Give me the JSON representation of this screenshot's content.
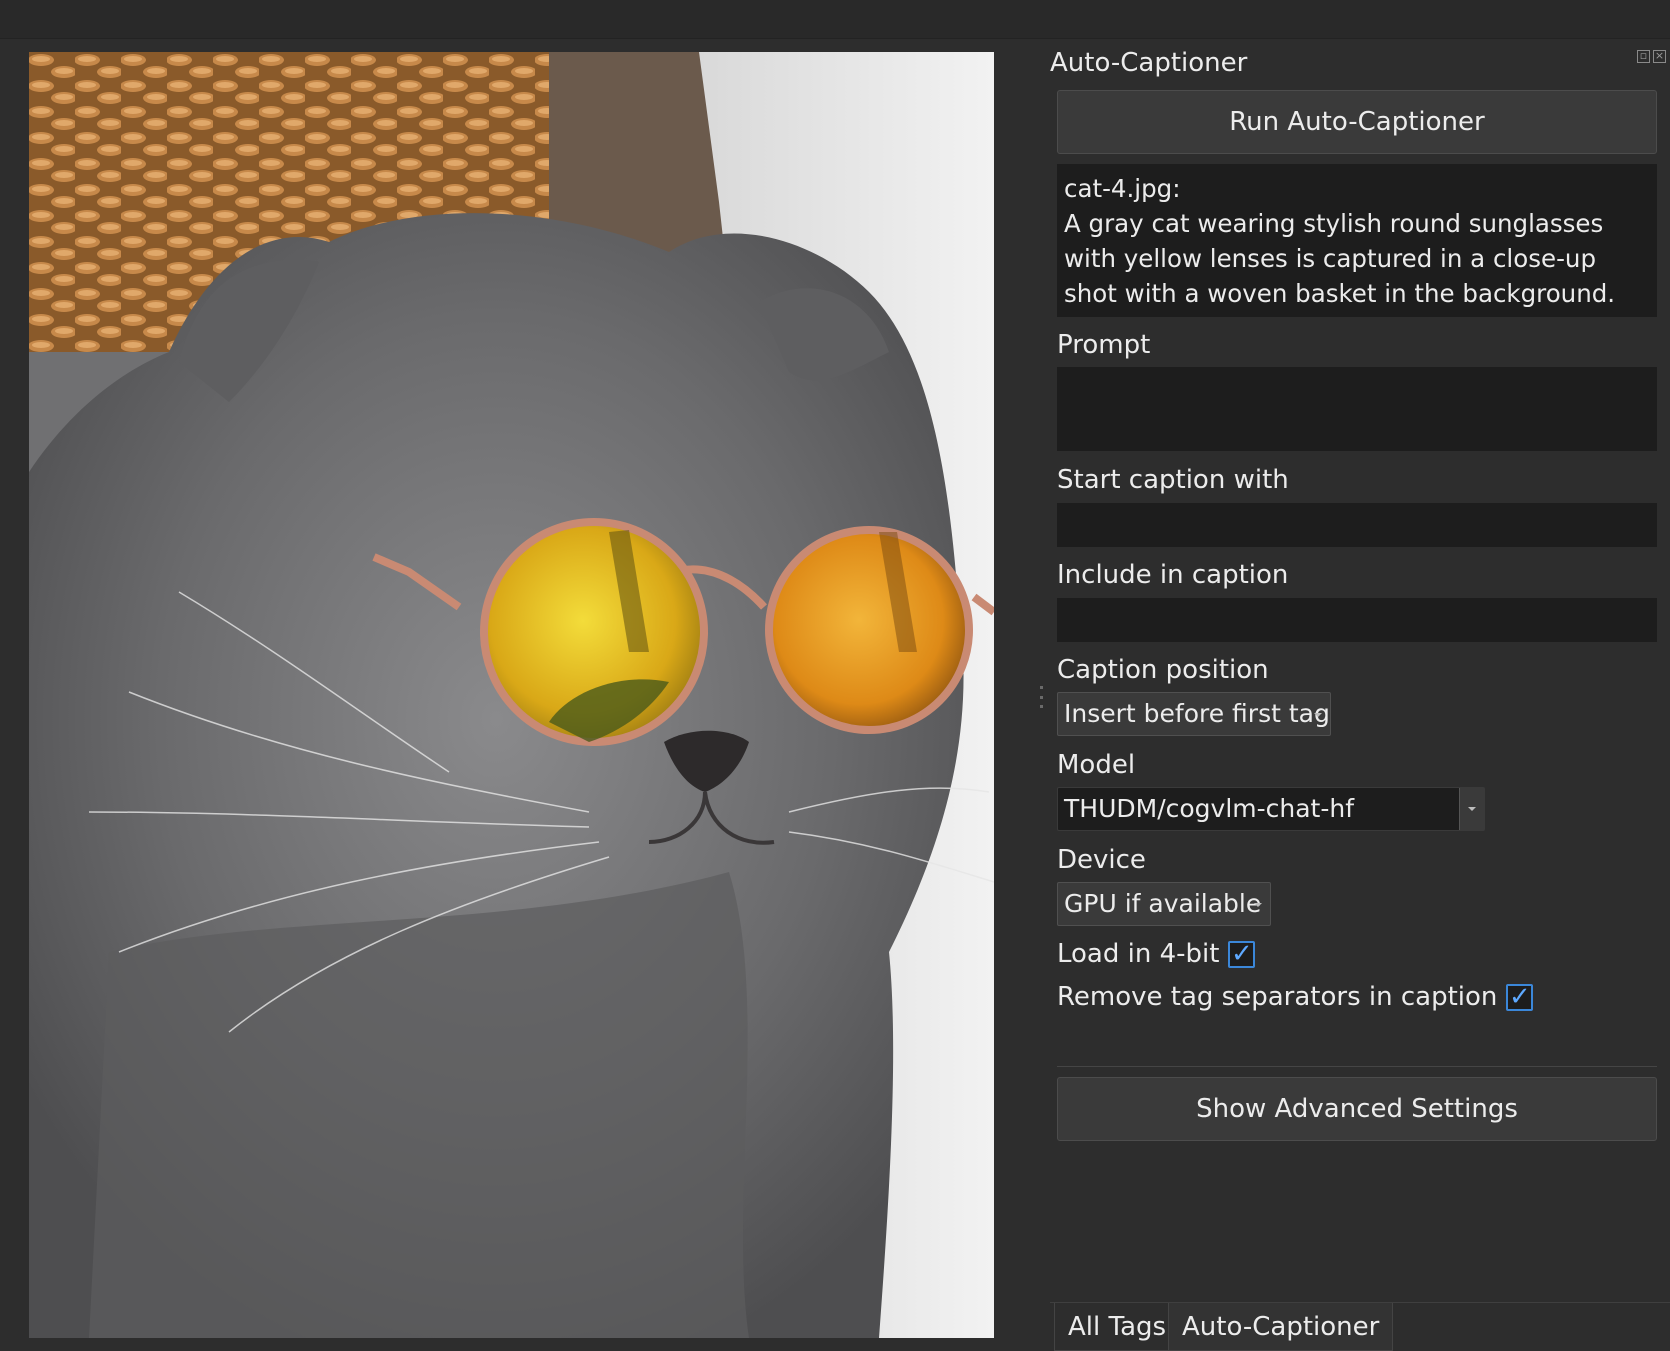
{
  "image": {
    "alt": "cat-4.jpg"
  },
  "dock": {
    "title": "Auto-Captioner",
    "run_button": "Run Auto-Captioner",
    "caption_output": {
      "filename": "cat-4.jpg:",
      "text": "A gray cat wearing stylish round sunglasses with yellow lenses is captured in a close-up shot with a woven basket in the background."
    },
    "prompt": {
      "label": "Prompt",
      "value": ""
    },
    "start_caption_with": {
      "label": "Start caption with",
      "value": ""
    },
    "include_in_caption": {
      "label": "Include in caption",
      "value": ""
    },
    "caption_position": {
      "label": "Caption position",
      "value": "Insert before first tag"
    },
    "model": {
      "label": "Model",
      "value": "THUDM/cogvlm-chat-hf"
    },
    "device": {
      "label": "Device",
      "value": "GPU if available"
    },
    "load_4bit": {
      "label": "Load in 4-bit",
      "checked": true
    },
    "remove_separators": {
      "label": "Remove tag separators in caption",
      "checked": true
    },
    "advanced_button": "Show Advanced Settings"
  },
  "tabs": [
    {
      "label": "All Tags",
      "active": false
    },
    {
      "label": "Auto-Captioner",
      "active": true
    }
  ],
  "colors": {
    "background": "#2d2d2d",
    "field": "#1d1d1d",
    "button": "#3a3a3a",
    "checkbox_accent": "#3b87d9",
    "lens_yellow": "#e6c21a",
    "lens_orange": "#e8901a",
    "cat_gray": "#6e6e70"
  }
}
